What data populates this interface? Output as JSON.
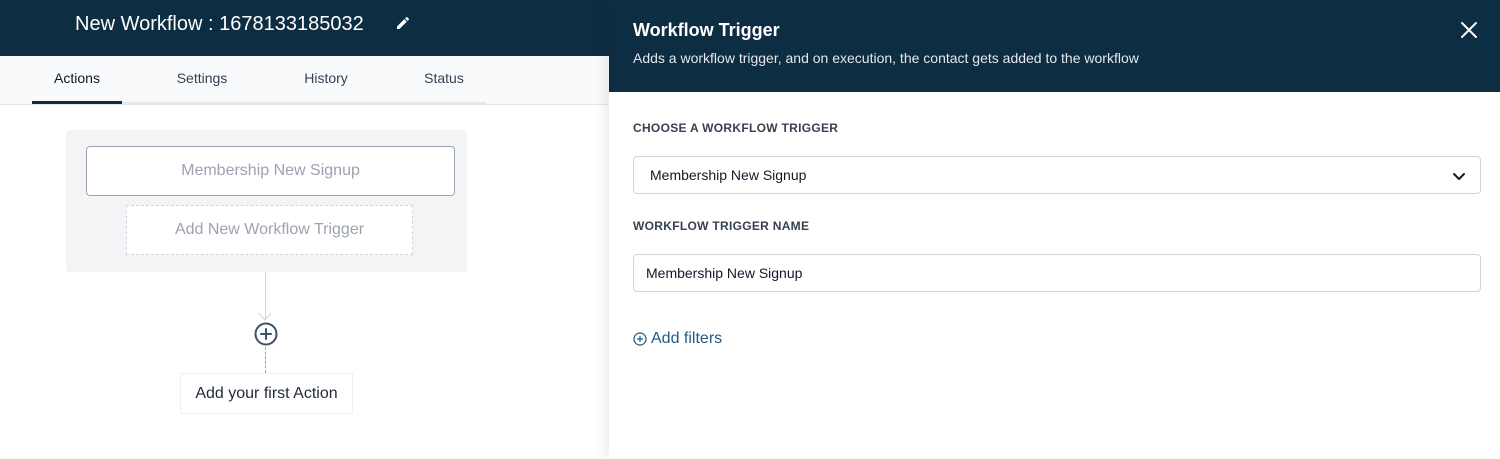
{
  "header": {
    "title": "New Workflow : 1678133185032"
  },
  "tabs": [
    {
      "label": "Actions",
      "active": true
    },
    {
      "label": "Settings",
      "active": false
    },
    {
      "label": "History",
      "active": false
    },
    {
      "label": "Status",
      "active": false
    }
  ],
  "canvas": {
    "trigger_card_label": "Membership New Signup",
    "add_trigger_label": "Add New Workflow Trigger",
    "first_action_label": "Add your first Action"
  },
  "drawer": {
    "title": "Workflow Trigger",
    "subtitle": "Adds a workflow trigger, and on execution, the contact gets added to the workflow",
    "choose_label": "CHOOSE A WORKFLOW TRIGGER",
    "selected_trigger": "Membership New Signup",
    "name_label": "WORKFLOW TRIGGER NAME",
    "name_value": "Membership New Signup",
    "add_filters_label": "Add filters"
  },
  "colors": {
    "header_bg": "#0c2d42",
    "link": "#1e5a85"
  }
}
